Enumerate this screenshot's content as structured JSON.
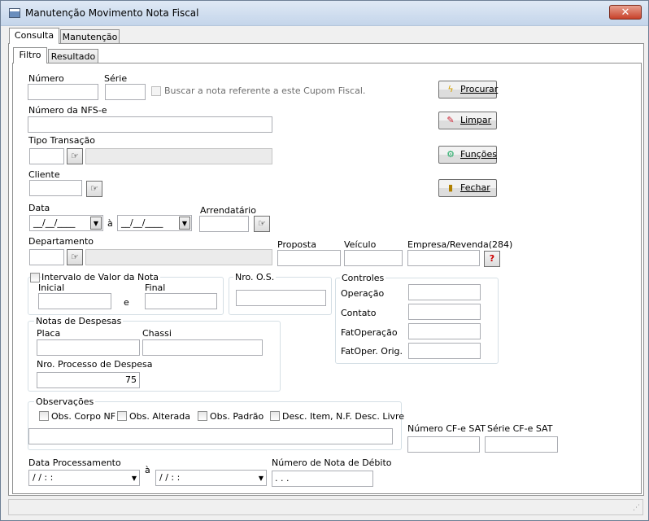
{
  "window": {
    "title": "Manutenção Movimento Nota Fiscal",
    "close_glyph": "✕"
  },
  "tabs": {
    "outer": [
      "Consulta",
      "Manutenção"
    ],
    "inner": [
      "Filtro",
      "Resultado"
    ]
  },
  "labels": {
    "numero": "Número",
    "serie": "Série",
    "buscar_cupom": "Buscar a nota referente a este Cupom Fiscal.",
    "numero_nfse": "Número da NFS-e",
    "tipo_transacao": "Tipo Transação",
    "cliente": "Cliente",
    "data": "Data",
    "a": "à",
    "arrendatario": "Arrendatário",
    "departamento": "Departamento",
    "proposta": "Proposta",
    "veiculo": "Veículo",
    "empresa_revenda": "Empresa/Revenda(284)",
    "intervalo_valor": "Intervalo de Valor da Nota",
    "inicial": "Inicial",
    "e": "e",
    "final": "Final",
    "nro_os": "Nro. O.S.",
    "controles": "Controles",
    "operacao": "Operação",
    "contato": "Contato",
    "fatoperacao": "FatOperação",
    "fatoper_orig": "FatOper. Orig.",
    "notas_despesas": "Notas de Despesas",
    "placa": "Placa",
    "chassi": "Chassi",
    "nro_processo": "Nro. Processo de Despesa",
    "observacoes": "Observações",
    "obs_corpo": "Obs. Corpo NF",
    "obs_alterada": "Obs. Alterada",
    "obs_padrao": "Obs. Padrão",
    "desc_item": "Desc. Item, N.F. Desc. Livre",
    "numero_cfe": "Número CF-e SAT",
    "serie_cfe": "Série CF-e SAT",
    "data_processamento": "Data Processamento",
    "numero_nota_debito": "Número de Nota de Débito"
  },
  "values": {
    "data_inicio": "__/__/____",
    "data_fim": "__/__/____",
    "nro_processo": "75",
    "proc_inicio": "/ /     : :",
    "proc_fim": "/ /     : :",
    "nota_debito": ". . ."
  },
  "buttons": {
    "procurar": {
      "label": "Procurar",
      "icon": "lightning-icon"
    },
    "limpar": {
      "label": "Limpar",
      "icon": "eraser-icon"
    },
    "funcoes": {
      "label": "Funções",
      "icon": "functions-icon"
    },
    "fechar": {
      "label": "Fechar",
      "icon": "door-icon"
    }
  },
  "colors": {
    "titlebar": "#c4d5ea",
    "close": "#c8412a",
    "panel_bg": "#ffffff"
  }
}
